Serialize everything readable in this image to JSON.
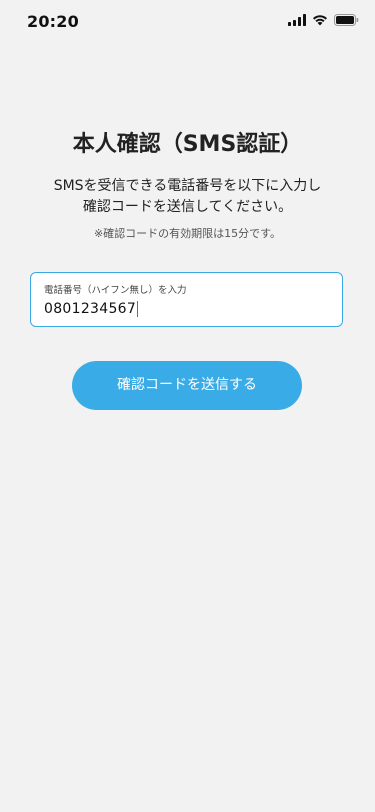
{
  "status_bar": {
    "time": "20:20",
    "icons": [
      "signal-icon",
      "wifi-icon",
      "battery-icon"
    ]
  },
  "page": {
    "title": "本人確認（SMS認証）",
    "description_line1": "SMSを受信できる電話番号を以下に入力し",
    "description_line2": "確認コードを送信してください。",
    "note": "※確認コードの有効期限は15分です。"
  },
  "phone_field": {
    "label": "電話番号（ハイフン無し）を入力",
    "value": "0801234567"
  },
  "send_button": {
    "label": "確認コードを送信する"
  },
  "colors": {
    "background": "#f2f2f2",
    "accent": "#39ace8",
    "field_border": "#3aa7e6"
  }
}
